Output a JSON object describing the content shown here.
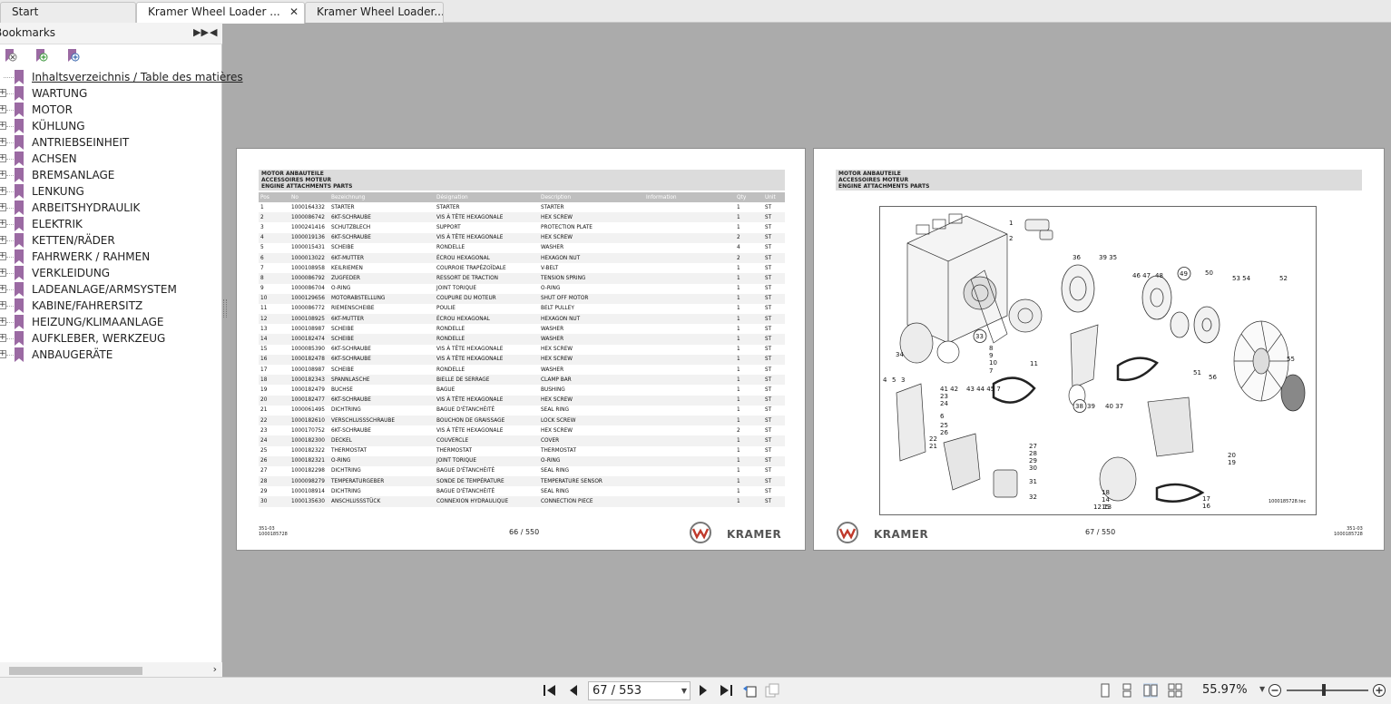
{
  "tabs": [
    {
      "label": "Start",
      "active": false
    },
    {
      "label": "Kramer Wheel Loader ...",
      "active": true
    },
    {
      "label": "Kramer Wheel Loader...",
      "active": false
    }
  ],
  "sidebar": {
    "title": "Bookmarks",
    "items": [
      {
        "label": "Inhaltsverzeichnis / Table des matières",
        "link": true
      },
      {
        "label": "WARTUNG"
      },
      {
        "label": "MOTOR"
      },
      {
        "label": "KÜHLUNG"
      },
      {
        "label": "ANTRIEBSEINHEIT"
      },
      {
        "label": "ACHSEN"
      },
      {
        "label": "BREMSANLAGE"
      },
      {
        "label": "LENKUNG"
      },
      {
        "label": "ARBEITSHYDRAULIK"
      },
      {
        "label": "ELEKTRIK"
      },
      {
        "label": "KETTEN/RÄDER"
      },
      {
        "label": "FAHRWERK / RAHMEN"
      },
      {
        "label": "VERKLEIDUNG"
      },
      {
        "label": "LADEANLAGE/ARMSYSTEM"
      },
      {
        "label": "KABINE/FAHRERSITZ"
      },
      {
        "label": "HEIZUNG/KLIMAANLAGE"
      },
      {
        "label": "AUFKLEBER, WERKZEUG"
      },
      {
        "label": "ANBAUGERÄTE"
      }
    ]
  },
  "left_page": {
    "header": [
      "MOTOR ANBAUTEILE",
      "ACCESSOIRES MOTEUR",
      "ENGINE ATTACHMENTS PARTS"
    ],
    "columns": [
      "Pos",
      "No",
      "Bezeichnung",
      "Désignation",
      "Description",
      "Information",
      "Qty",
      "Unit"
    ],
    "rows": [
      [
        "1",
        "1000164332",
        "STARTER",
        "STARTER",
        "STARTER",
        "",
        "1",
        "ST"
      ],
      [
        "2",
        "1000086742",
        "6KT-SCHRAUBE",
        "VIS À TÊTE HEXAGONALE",
        "HEX SCREW",
        "",
        "1",
        "ST"
      ],
      [
        "3",
        "1000241416",
        "SCHUTZBLECH",
        "SUPPORT",
        "PROTECTION PLATE",
        "",
        "1",
        "ST"
      ],
      [
        "4",
        "1000019136",
        "6KT-SCHRAUBE",
        "VIS À TÊTE HEXAGONALE",
        "HEX SCREW",
        "",
        "2",
        "ST"
      ],
      [
        "5",
        "1000015431",
        "SCHEIBE",
        "RONDELLE",
        "WASHER",
        "",
        "4",
        "ST"
      ],
      [
        "6",
        "1000013022",
        "6KT-MUTTER",
        "ÉCROU HEXAGONAL",
        "HEXAGON NUT",
        "",
        "2",
        "ST"
      ],
      [
        "7",
        "1000108958",
        "KEILRIEMEN",
        "COURROIE TRAPÉZOÏDALE",
        "V-BELT",
        "",
        "1",
        "ST"
      ],
      [
        "8",
        "1000086792",
        "ZUGFEDER",
        "RESSORT DE TRACTION",
        "TENSION SPRING",
        "",
        "1",
        "ST"
      ],
      [
        "9",
        "1000086704",
        "O-RING",
        "JOINT TORIQUE",
        "O-RING",
        "",
        "1",
        "ST"
      ],
      [
        "10",
        "1000129656",
        "MOTORABSTELLUNG",
        "COUPURE DU MOTEUR",
        "SHUT OFF MOTOR",
        "",
        "1",
        "ST"
      ],
      [
        "11",
        "1000086772",
        "RIEMENSCHEIBE",
        "POULIE",
        "BELT PULLEY",
        "",
        "1",
        "ST"
      ],
      [
        "12",
        "1000108925",
        "6KT-MUTTER",
        "ÉCROU HEXAGONAL",
        "HEXAGON NUT",
        "",
        "1",
        "ST"
      ],
      [
        "13",
        "1000108987",
        "SCHEIBE",
        "RONDELLE",
        "WASHER",
        "",
        "1",
        "ST"
      ],
      [
        "14",
        "1000182474",
        "SCHEIBE",
        "RONDELLE",
        "WASHER",
        "",
        "1",
        "ST"
      ],
      [
        "15",
        "1000085390",
        "6KT-SCHRAUBE",
        "VIS À TÊTE HEXAGONALE",
        "HEX SCREW",
        "",
        "1",
        "ST"
      ],
      [
        "16",
        "1000182478",
        "6KT-SCHRAUBE",
        "VIS À TÊTE HEXAGONALE",
        "HEX SCREW",
        "",
        "1",
        "ST"
      ],
      [
        "17",
        "1000108987",
        "SCHEIBE",
        "RONDELLE",
        "WASHER",
        "",
        "1",
        "ST"
      ],
      [
        "18",
        "1000182343",
        "SPANNLASCHE",
        "BIELLE DE SERRAGE",
        "CLAMP BAR",
        "",
        "1",
        "ST"
      ],
      [
        "19",
        "1000182479",
        "BUCHSE",
        "BAGUE",
        "BUSHING",
        "",
        "1",
        "ST"
      ],
      [
        "20",
        "1000182477",
        "6KT-SCHRAUBE",
        "VIS À TÊTE HEXAGONALE",
        "HEX SCREW",
        "",
        "1",
        "ST"
      ],
      [
        "21",
        "1000061495",
        "DICHTRING",
        "BAGUE D'ÉTANCHÉITÉ",
        "SEAL RING",
        "",
        "1",
        "ST"
      ],
      [
        "22",
        "1000182610",
        "VERSCHLUSSSCHRAUBE",
        "BOUCHON DE GRAISSAGE",
        "LOCK SCREW",
        "",
        "1",
        "ST"
      ],
      [
        "23",
        "1000170752",
        "6KT-SCHRAUBE",
        "VIS À TÊTE HEXAGONALE",
        "HEX SCREW",
        "",
        "2",
        "ST"
      ],
      [
        "24",
        "1000182300",
        "DECKEL",
        "COUVERCLE",
        "COVER",
        "",
        "1",
        "ST"
      ],
      [
        "25",
        "1000182322",
        "THERMOSTAT",
        "THERMOSTAT",
        "THERMOSTAT",
        "",
        "1",
        "ST"
      ],
      [
        "26",
        "1000182321",
        "O-RING",
        "JOINT TORIQUE",
        "O-RING",
        "",
        "1",
        "ST"
      ],
      [
        "27",
        "1000182298",
        "DICHTRING",
        "BAGUE D'ÉTANCHÉITÉ",
        "SEAL RING",
        "",
        "1",
        "ST"
      ],
      [
        "28",
        "1000098279",
        "TEMPERATURGEBER",
        "SONDE DE TEMPÉRATURE",
        "TEMPERATURE SENSOR",
        "",
        "1",
        "ST"
      ],
      [
        "29",
        "1000108914",
        "DICHTRING",
        "BAGUE D'ÉTANCHÉITÉ",
        "SEAL RING",
        "",
        "1",
        "ST"
      ],
      [
        "30",
        "1000135630",
        "ANSCHLUSSSTÜCK",
        "CONNEXION HYDRAULIQUE",
        "CONNECTION PIECE",
        "",
        "1",
        "ST"
      ]
    ],
    "foot_code": [
      "351-03",
      "1000185728"
    ],
    "page_label": "66 / 550",
    "brand": "KRAMER"
  },
  "right_page": {
    "header": [
      "MOTOR ANBAUTEILE",
      "ACCESSOIRES MOTEUR",
      "ENGINE ATTACHMENTS PARTS"
    ],
    "diagram_id": "1000185728.tec",
    "foot_code": [
      "351-03",
      "1000185728"
    ],
    "page_label": "67 / 550",
    "brand": "KRAMER",
    "callouts": [
      "1",
      "2",
      "36",
      "39 35",
      "46 47",
      "48",
      "49",
      "50",
      "53 54",
      "52",
      "33",
      "8",
      "9",
      "10",
      "7",
      "11",
      "34",
      "4",
      "5",
      "3",
      "41 42",
      "43 44 45 7",
      "23",
      "24",
      "6",
      "25",
      "26",
      "22",
      "21",
      "38",
      "39",
      "40 37",
      "55",
      "51",
      "56",
      "27",
      "28",
      "29",
      "30",
      "31",
      "32",
      "20",
      "19",
      "18",
      "14",
      "15",
      "17",
      "16",
      "12 13"
    ]
  },
  "toolbar": {
    "page_value": "67 / 553",
    "zoom": "55.97%"
  },
  "colors": {
    "viewer_background": "#ababab",
    "bookmark_icon": "#9b6aa3",
    "table_header": "#bfbfbf",
    "page_header_band": "#dcdcdc"
  }
}
